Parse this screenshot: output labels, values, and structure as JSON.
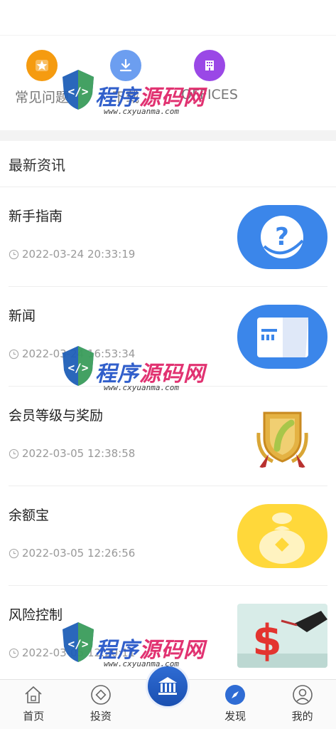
{
  "quick_links": [
    {
      "label": "常见问题",
      "icon": "star-badge-icon",
      "color": "#f59b10"
    },
    {
      "label": "下载",
      "icon": "download-icon",
      "color": "#6c9ef0"
    },
    {
      "label": "OFFICES",
      "icon": "building-icon",
      "color": "#9a48e6"
    }
  ],
  "news": {
    "heading": "最新资讯",
    "items": [
      {
        "title": "新手指南",
        "time": "2022-03-24 20:33:19",
        "thumb": "question-thumb"
      },
      {
        "title": "新闻",
        "time": "2022-03-24 16:53:34",
        "thumb": "newspaper-thumb"
      },
      {
        "title": "会员等级与奖励",
        "time": "2022-03-05 12:38:58",
        "thumb": "medal-thumb"
      },
      {
        "title": "余额宝",
        "time": "2022-03-05 12:26:56",
        "thumb": "money-bag-thumb"
      },
      {
        "title": "风险控制",
        "time": "2022-03-05 12:20:11",
        "thumb": "risk-dollar-thumb"
      }
    ]
  },
  "tabbar": {
    "tabs": [
      {
        "label": "首页",
        "icon": "home-icon"
      },
      {
        "label": "投资",
        "icon": "invest-icon"
      },
      {
        "label": "",
        "icon": "bank-icon"
      },
      {
        "label": "发现",
        "icon": "compass-icon"
      },
      {
        "label": "我的",
        "icon": "user-icon"
      }
    ]
  },
  "watermark": {
    "name_a": "程序",
    "name_b": "源码网",
    "url": "www.cxyuanma.com"
  },
  "colors": {
    "accent_blue": "#2f6cd4",
    "text_gray": "#999999"
  }
}
